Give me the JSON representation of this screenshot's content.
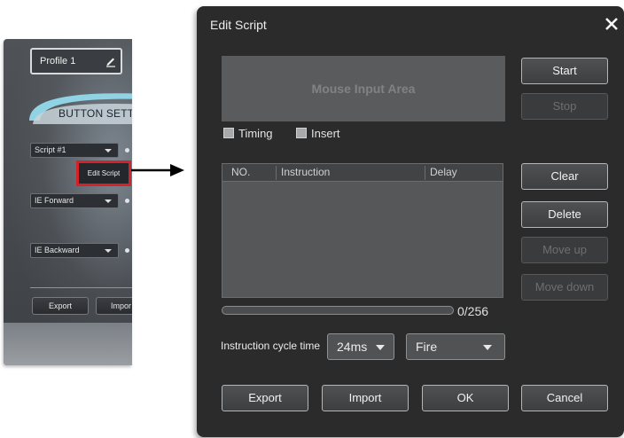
{
  "left_panel": {
    "profile_label": "Profile 1",
    "section_title": "BUTTON SETTIN",
    "dropdowns": [
      {
        "label": "Script #1"
      },
      {
        "label": "IE Forward"
      },
      {
        "label": "IE Backward"
      }
    ],
    "edit_script_button": "Edit Script",
    "export_button": "Export",
    "import_button": "Impor"
  },
  "dialog": {
    "title": "Edit Script",
    "mouse_area_label": "Mouse Input Area",
    "checkboxes": {
      "timing": "Timing",
      "insert": "Insert"
    },
    "list_headers": {
      "no": "NO.",
      "instruction": "Instruction",
      "delay": "Delay"
    },
    "progress_fraction": 0,
    "counter": "0/256",
    "cycle_label": "Instruction cycle time",
    "cycle_value": "24ms",
    "button_type": "Fire",
    "side_buttons": {
      "start": "Start",
      "stop": "Stop",
      "clear": "Clear",
      "delete": "Delete",
      "move_up": "Move up",
      "move_down": "Move down"
    },
    "bottom_buttons": {
      "export": "Export",
      "import": "Import",
      "ok": "OK",
      "cancel": "Cancel"
    }
  }
}
